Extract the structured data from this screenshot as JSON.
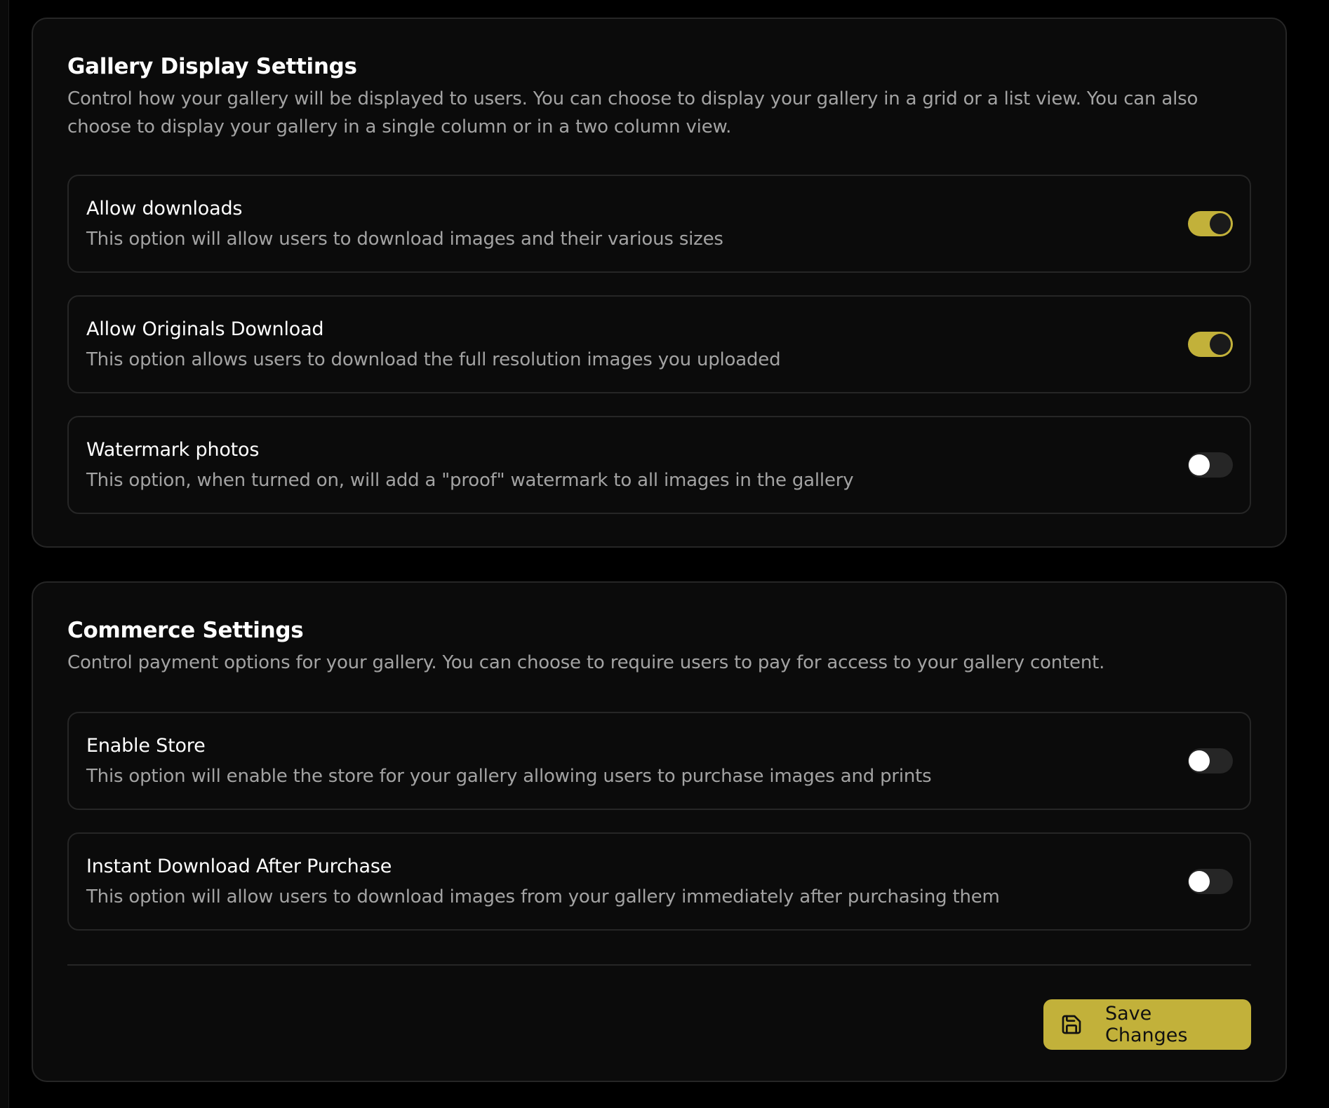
{
  "colors": {
    "accent": "#c2b13a",
    "background": "#000000",
    "card": "#0b0b0b",
    "border": "#262626",
    "muted_text": "#a3a3a3"
  },
  "gallery_display": {
    "title": "Gallery Display Settings",
    "description": "Control how your gallery will be displayed to users. You can choose to display your gallery in a grid or a list view. You can also choose to display your gallery in a single column or in a two column view.",
    "options": [
      {
        "title": "Allow downloads",
        "description": "This option will allow users to download images and their various sizes",
        "enabled": true
      },
      {
        "title": "Allow Originals Download",
        "description": "This option allows users to download the full resolution images you uploaded",
        "enabled": true
      },
      {
        "title": "Watermark photos",
        "description": "This option, when turned on, will add a \"proof\" watermark to all images in the gallery",
        "enabled": false
      }
    ]
  },
  "commerce": {
    "title": "Commerce Settings",
    "description": "Control payment options for your gallery. You can choose to require users to pay for access to your gallery content.",
    "options": [
      {
        "title": "Enable Store",
        "description": "This option will enable the store for your gallery allowing users to purchase images and prints",
        "enabled": false
      },
      {
        "title": "Instant Download After Purchase",
        "description": "This option will allow users to download images from your gallery immediately after purchasing them",
        "enabled": false
      }
    ]
  },
  "footer": {
    "save_label": "Save Changes",
    "save_icon": "floppy-disk-icon"
  }
}
